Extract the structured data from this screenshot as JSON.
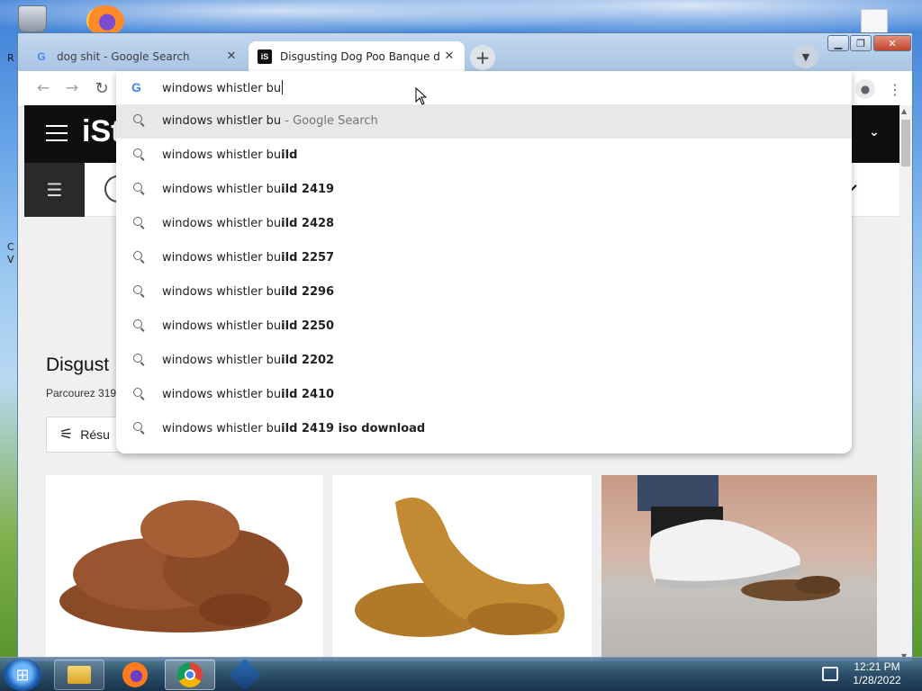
{
  "desktop": {
    "left_edge_texts": [
      "R",
      "C",
      "V"
    ]
  },
  "tabs": [
    {
      "title": "dog shit - Google Search",
      "favicon": "google-g-icon",
      "active": false
    },
    {
      "title": "Disgusting Dog Poo Banque d'im",
      "favicon": "istock-icon",
      "active": true
    }
  ],
  "window_controls": {
    "minimize": "minimize-icon",
    "maximize": "maximize-icon",
    "close": "close-icon"
  },
  "omnibox": {
    "input_value": "windows whistler bu",
    "suggestions": [
      {
        "typed": "windows whistler bu",
        "completion": "",
        "meta": " - Google Search",
        "selected": true
      },
      {
        "typed": "windows whistler bu",
        "completion": "ild",
        "meta": "",
        "selected": false
      },
      {
        "typed": "windows whistler bu",
        "completion": "ild 2419",
        "meta": "",
        "selected": false
      },
      {
        "typed": "windows whistler bu",
        "completion": "ild 2428",
        "meta": "",
        "selected": false
      },
      {
        "typed": "windows whistler bu",
        "completion": "ild 2257",
        "meta": "",
        "selected": false
      },
      {
        "typed": "windows whistler bu",
        "completion": "ild 2296",
        "meta": "",
        "selected": false
      },
      {
        "typed": "windows whistler bu",
        "completion": "ild 2250",
        "meta": "",
        "selected": false
      },
      {
        "typed": "windows whistler bu",
        "completion": "ild 2202",
        "meta": "",
        "selected": false
      },
      {
        "typed": "windows whistler bu",
        "completion": "ild 2410",
        "meta": "",
        "selected": false
      },
      {
        "typed": "windows whistler bu",
        "completion": "ild 2419 iso download",
        "meta": "",
        "selected": false
      }
    ]
  },
  "page": {
    "logo_text": "iSt",
    "heading": "Disgust",
    "subheading": "Parcourez 319",
    "results_button": "Résu",
    "images": [
      {
        "alt_name": "dog-poo-image-1"
      },
      {
        "alt_name": "dog-poo-image-2"
      },
      {
        "alt_name": "sneaker-stepping-image"
      }
    ]
  },
  "taskbar": {
    "apps": [
      "explorer-icon",
      "firefox-icon",
      "chrome-icon",
      "virtualbox-icon"
    ],
    "clock_time": "12:21 PM",
    "clock_date": "1/28/2022"
  },
  "colors": {
    "accent_google_blue": "#4285f4",
    "header_black": "#0f0f0f",
    "selected_suggestion_bg": "#e8e8e8"
  }
}
